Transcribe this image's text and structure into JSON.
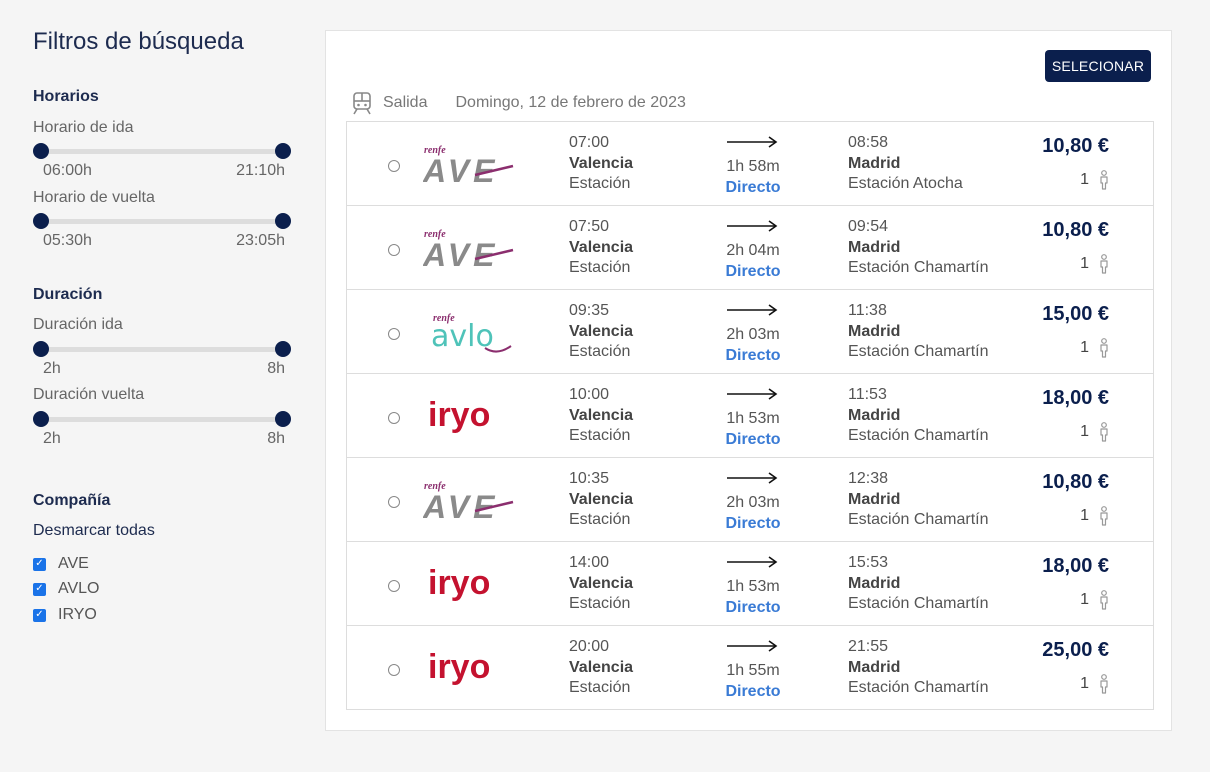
{
  "filters": {
    "title": "Filtros de búsqueda",
    "schedules": {
      "title": "Horarios",
      "outbound": {
        "label": "Horario de ida",
        "min": "06:00h",
        "max": "21:10h"
      },
      "return": {
        "label": "Horario de vuelta",
        "min": "05:30h",
        "max": "23:05h"
      }
    },
    "duration": {
      "title": "Duración",
      "outbound": {
        "label": "Duración ida",
        "min": "2h",
        "max": "8h"
      },
      "return": {
        "label": "Duración vuelta",
        "min": "2h",
        "max": "8h"
      }
    },
    "company": {
      "title": "Compañía",
      "uncheck_all": "Desmarcar todas",
      "items": [
        {
          "label": "AVE",
          "checked": true
        },
        {
          "label": "AVLO",
          "checked": true
        },
        {
          "label": "IRYO",
          "checked": true
        }
      ]
    }
  },
  "panel": {
    "select_button": "SELECIONAR",
    "direction": "Salida",
    "date": "Domingo, 12 de febrero de 2023"
  },
  "trips": [
    {
      "operator": "AVE",
      "dep_time": "07:00",
      "dep_city": "Valencia",
      "dep_station": "Estación",
      "duration": "1h 58m",
      "type": "Directo",
      "arr_time": "08:58",
      "arr_city": "Madrid",
      "arr_station": "Estación Atocha",
      "price": "10,80 €",
      "passengers": "1"
    },
    {
      "operator": "AVE",
      "dep_time": "07:50",
      "dep_city": "Valencia",
      "dep_station": "Estación",
      "duration": "2h 04m",
      "type": "Directo",
      "arr_time": "09:54",
      "arr_city": "Madrid",
      "arr_station": "Estación Chamartín",
      "price": "10,80 €",
      "passengers": "1"
    },
    {
      "operator": "AVLO",
      "dep_time": "09:35",
      "dep_city": "Valencia",
      "dep_station": "Estación",
      "duration": "2h 03m",
      "type": "Directo",
      "arr_time": "11:38",
      "arr_city": "Madrid",
      "arr_station": "Estación Chamartín",
      "price": "15,00 €",
      "passengers": "1"
    },
    {
      "operator": "IRYO",
      "dep_time": "10:00",
      "dep_city": "Valencia",
      "dep_station": "Estación",
      "duration": "1h 53m",
      "type": "Directo",
      "arr_time": "11:53",
      "arr_city": "Madrid",
      "arr_station": "Estación Chamartín",
      "price": "18,00 €",
      "passengers": "1"
    },
    {
      "operator": "AVE",
      "dep_time": "10:35",
      "dep_city": "Valencia",
      "dep_station": "Estación",
      "duration": "2h 03m",
      "type": "Directo",
      "arr_time": "12:38",
      "arr_city": "Madrid",
      "arr_station": "Estación Chamartín",
      "price": "10,80 €",
      "passengers": "1"
    },
    {
      "operator": "IRYO",
      "dep_time": "14:00",
      "dep_city": "Valencia",
      "dep_station": "Estación",
      "duration": "1h 53m",
      "type": "Directo",
      "arr_time": "15:53",
      "arr_city": "Madrid",
      "arr_station": "Estación Chamartín",
      "price": "18,00 €",
      "passengers": "1"
    },
    {
      "operator": "IRYO",
      "dep_time": "20:00",
      "dep_city": "Valencia",
      "dep_station": "Estación",
      "duration": "1h 55m",
      "type": "Directo",
      "arr_time": "21:55",
      "arr_city": "Madrid",
      "arr_station": "Estación Chamartín",
      "price": "25,00 €",
      "passengers": "1"
    }
  ],
  "logos": {
    "ave": {
      "brand": "renfe",
      "name": "AVE"
    },
    "avlo": {
      "brand": "renfe",
      "name": "avlo"
    },
    "iryo": {
      "name": "iryo"
    }
  },
  "colors": {
    "navy": "#0b1f4d",
    "link_blue": "#3a7bd5",
    "renfe_purple": "#8b2e6e",
    "ave_gray": "#8a8a8a",
    "avlo_teal": "#4fc3b9",
    "iryo_red": "#c4122f"
  }
}
